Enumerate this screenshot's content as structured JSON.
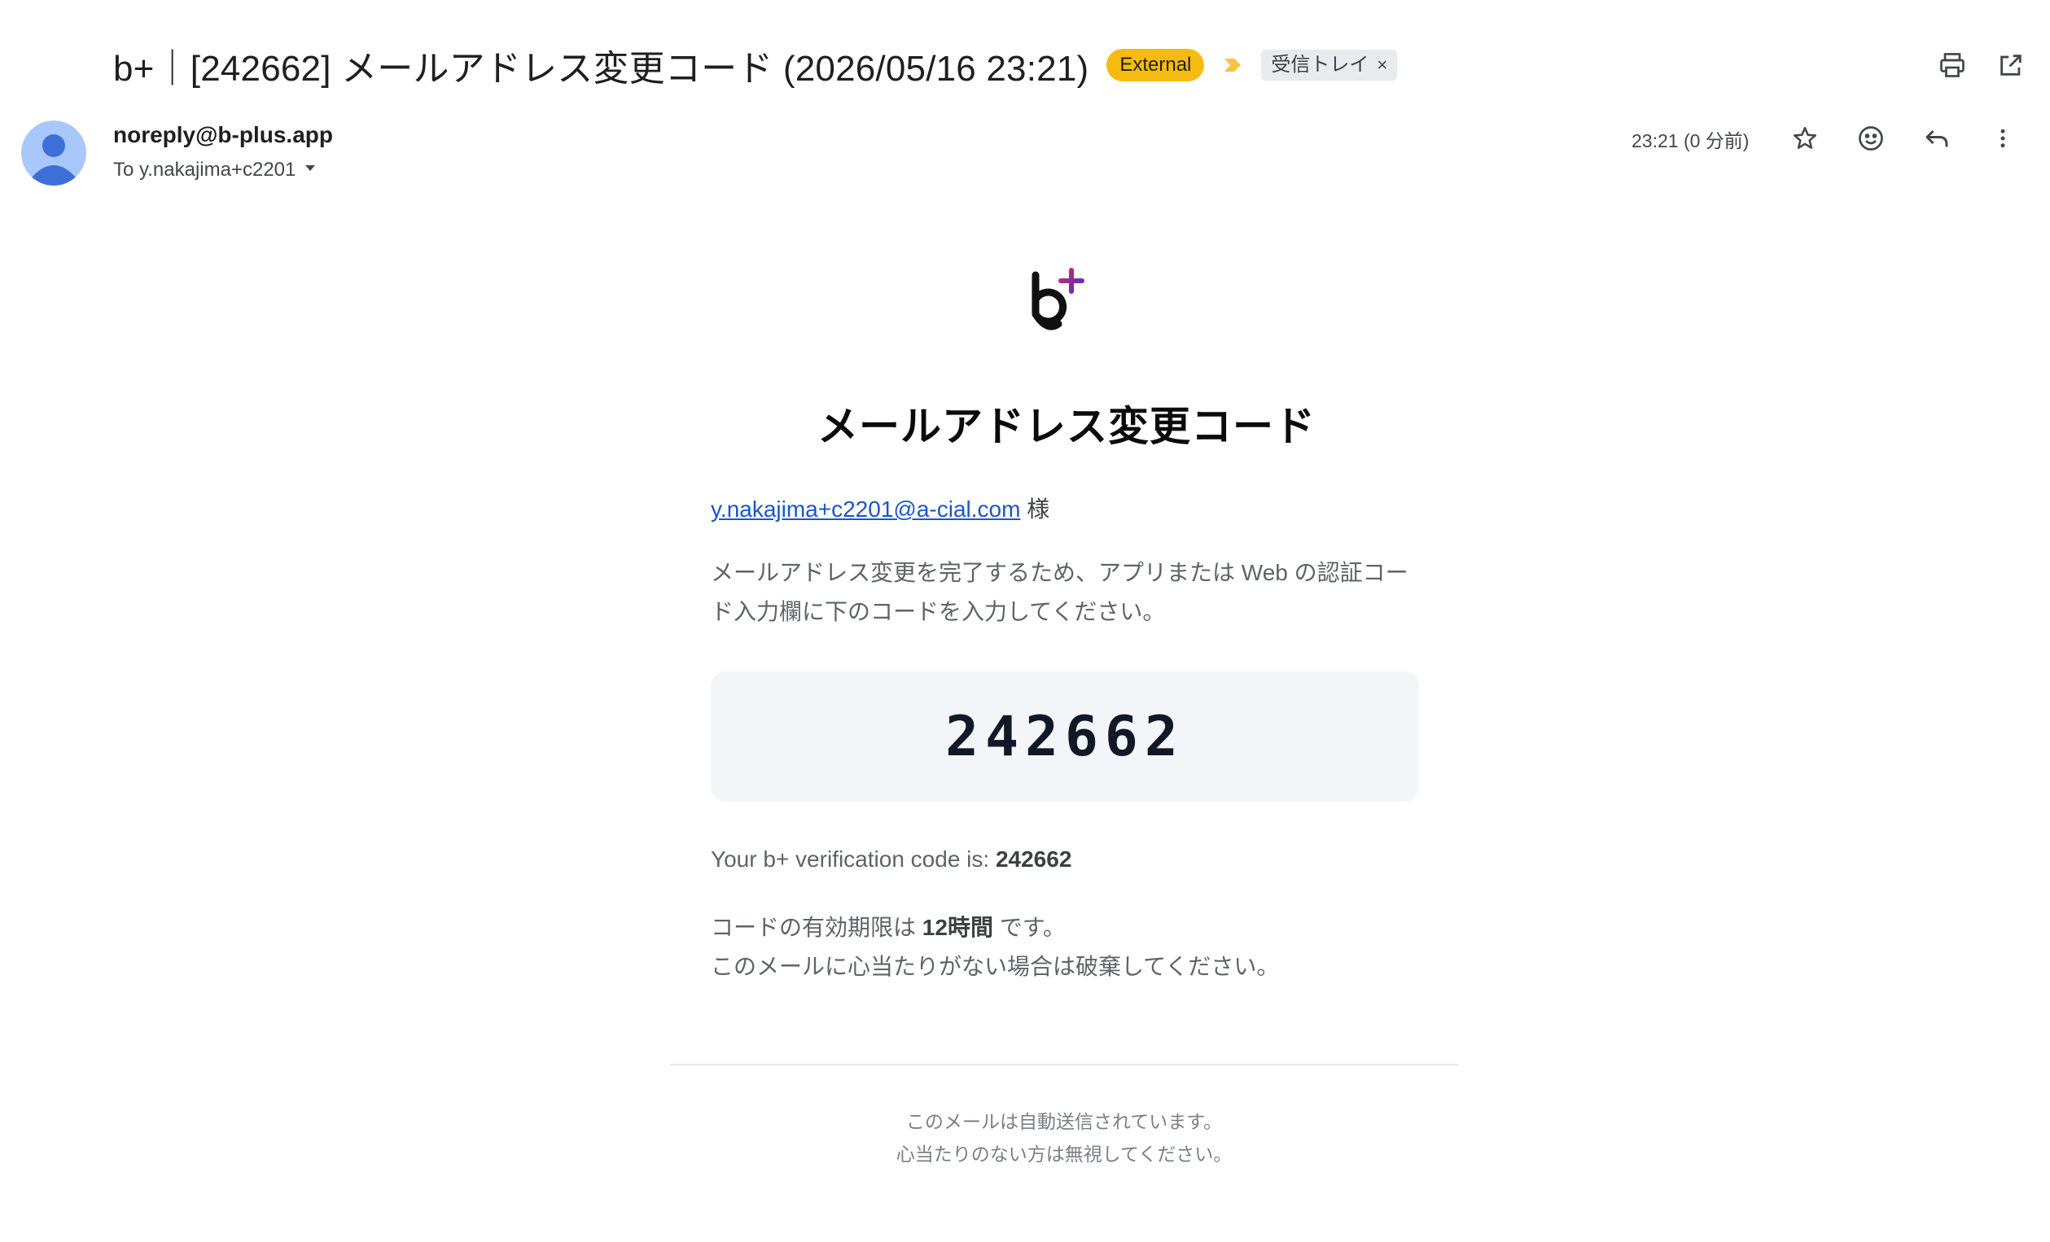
{
  "subject": {
    "title": "b+｜[242662] メールアドレス変更コード (2026/05/16 23:21)",
    "external_label": "External",
    "inbox_label": "受信トレイ",
    "remove_label": "×"
  },
  "toolbar": {
    "icons": [
      "printer-icon",
      "open-in-new-window-icon"
    ]
  },
  "sender": {
    "email": "noreply@b-plus.app",
    "recipient": "To y.nakajima+c2201",
    "timestamp": "23:21 (0 分前)"
  },
  "actions": {
    "icons": [
      "star-icon",
      "emoji-reaction-icon",
      "reply-icon",
      "more-vert-icon"
    ]
  },
  "email": {
    "title": "メールアドレス変更コード",
    "recipient_link": "y.nakajima+c2201@a-cial.com",
    "honorific": "様",
    "instructions": "メールアドレス変更を完了するため、アプリまたは Web の認証コード入力欄に下のコードを入力してください。",
    "code": "242662",
    "english_prefix": "Your b+ verification code is:",
    "english_code": "242662",
    "expiry_prefix": "コードの有効期限は",
    "expiry_value": "12時間",
    "expiry_suffix": "です。",
    "discard_notice": "このメールに心当たりがない場合は破棄してください。",
    "footer_line1": "このメールは自動送信されています。",
    "footer_line2": "心当たりのない方は無視してください。"
  },
  "colors": {
    "external_badge": "#f6bb10",
    "link": "#1a56c8",
    "avatar": "#a8c7fa",
    "logo_plus_start": "#e0245e",
    "logo_plus_end": "#3a36d6"
  }
}
